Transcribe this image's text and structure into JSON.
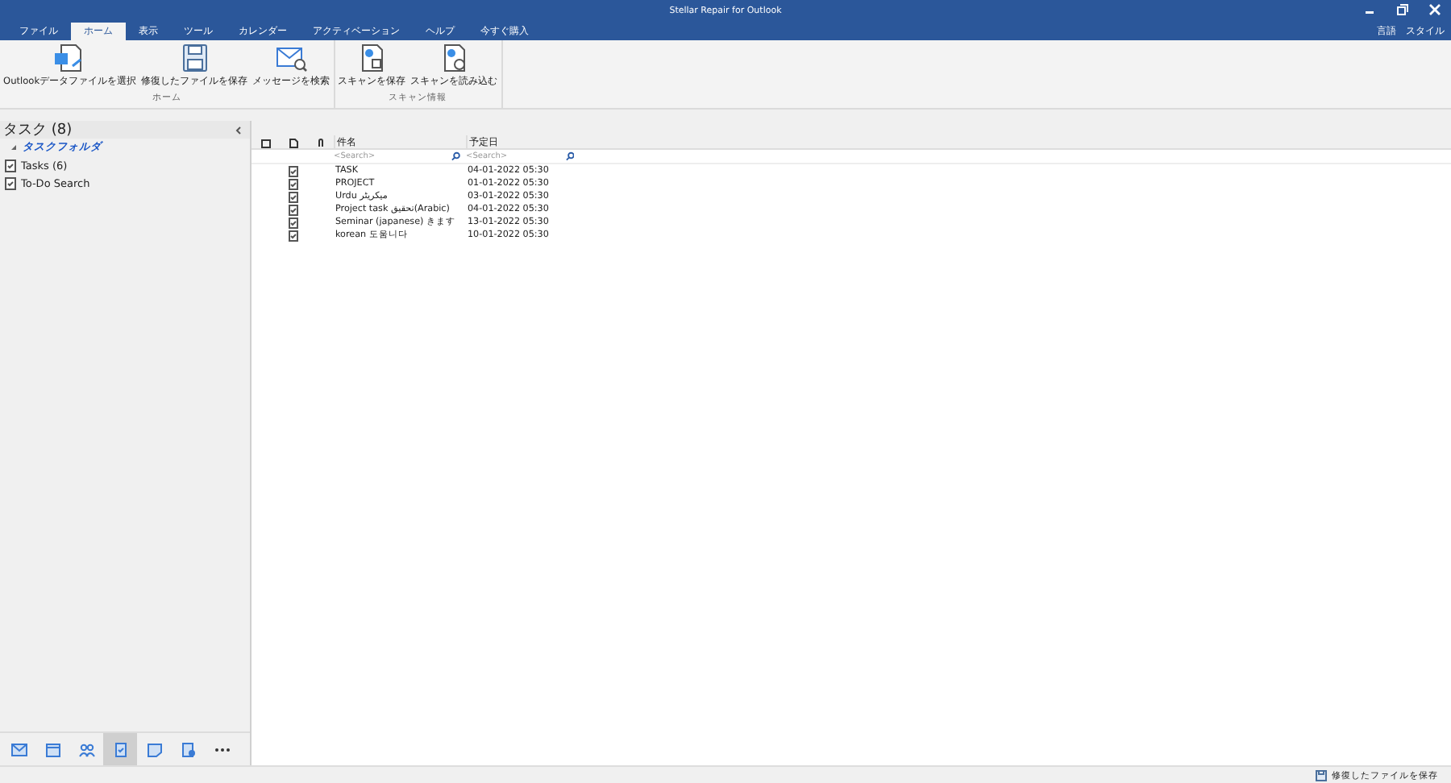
{
  "window": {
    "title": "Stellar Repair for Outlook",
    "right_controls": [
      "言語",
      "スタイル"
    ]
  },
  "tabs": [
    {
      "label": "ファイル",
      "selected": false
    },
    {
      "label": "ホーム",
      "selected": true
    },
    {
      "label": "表示",
      "selected": false
    },
    {
      "label": "ツール",
      "selected": false
    },
    {
      "label": "カレンダー",
      "selected": false
    },
    {
      "label": "アクティベーション",
      "selected": false
    },
    {
      "label": "ヘルプ",
      "selected": false
    },
    {
      "label": "今すぐ購入",
      "selected": false
    }
  ],
  "ribbon_groups": [
    {
      "label": "ホーム",
      "buttons": [
        {
          "label": "Outlookデータファイルを選択",
          "kind": "open"
        },
        {
          "label": "修復したファイルを保存",
          "kind": "save"
        },
        {
          "label": "メッセージを検索",
          "kind": "search"
        }
      ]
    },
    {
      "label": "スキャン情報",
      "buttons": [
        {
          "label": "スキャンを保存",
          "kind": "scansave"
        },
        {
          "label": "スキャンを読み込む",
          "kind": "scanload"
        }
      ]
    }
  ],
  "left_pane": {
    "title": "タスク (8)",
    "items": [
      {
        "label": "タスクフォルダ",
        "kind": "folder",
        "selected": true
      },
      {
        "label": "Tasks (6)",
        "kind": "task",
        "selected": false
      },
      {
        "label": "To-Do Search",
        "kind": "task",
        "selected": false
      }
    ]
  },
  "table": {
    "columns": [
      "件名",
      "予定日"
    ],
    "search_placeholders": [
      "<Search>",
      "<Search>"
    ],
    "rows": [
      {
        "subject": "TASK",
        "due": "04-01-2022 05:30"
      },
      {
        "subject": "PROJECT",
        "due": "01-01-2022 05:30"
      },
      {
        "subject": "Urdu میکریٹر",
        "due": "03-01-2022 05:30"
      },
      {
        "subject": "Project task تحقیق(Arabic)",
        "due": "04-01-2022 05:30"
      },
      {
        "subject": "Seminar (japanese) きます",
        "due": "13-01-2022 05:30"
      },
      {
        "subject": "korean 도움니다",
        "due": "10-01-2022 05:30"
      }
    ]
  },
  "nav": [
    {
      "kind": "mail",
      "selected": false
    },
    {
      "kind": "calendar",
      "selected": false
    },
    {
      "kind": "contacts",
      "selected": false
    },
    {
      "kind": "tasks",
      "selected": true
    },
    {
      "kind": "notes",
      "selected": false
    },
    {
      "kind": "journal",
      "selected": false
    },
    {
      "kind": "more",
      "selected": false
    }
  ],
  "status_bar": {
    "text": "修復したファイルを保存"
  }
}
